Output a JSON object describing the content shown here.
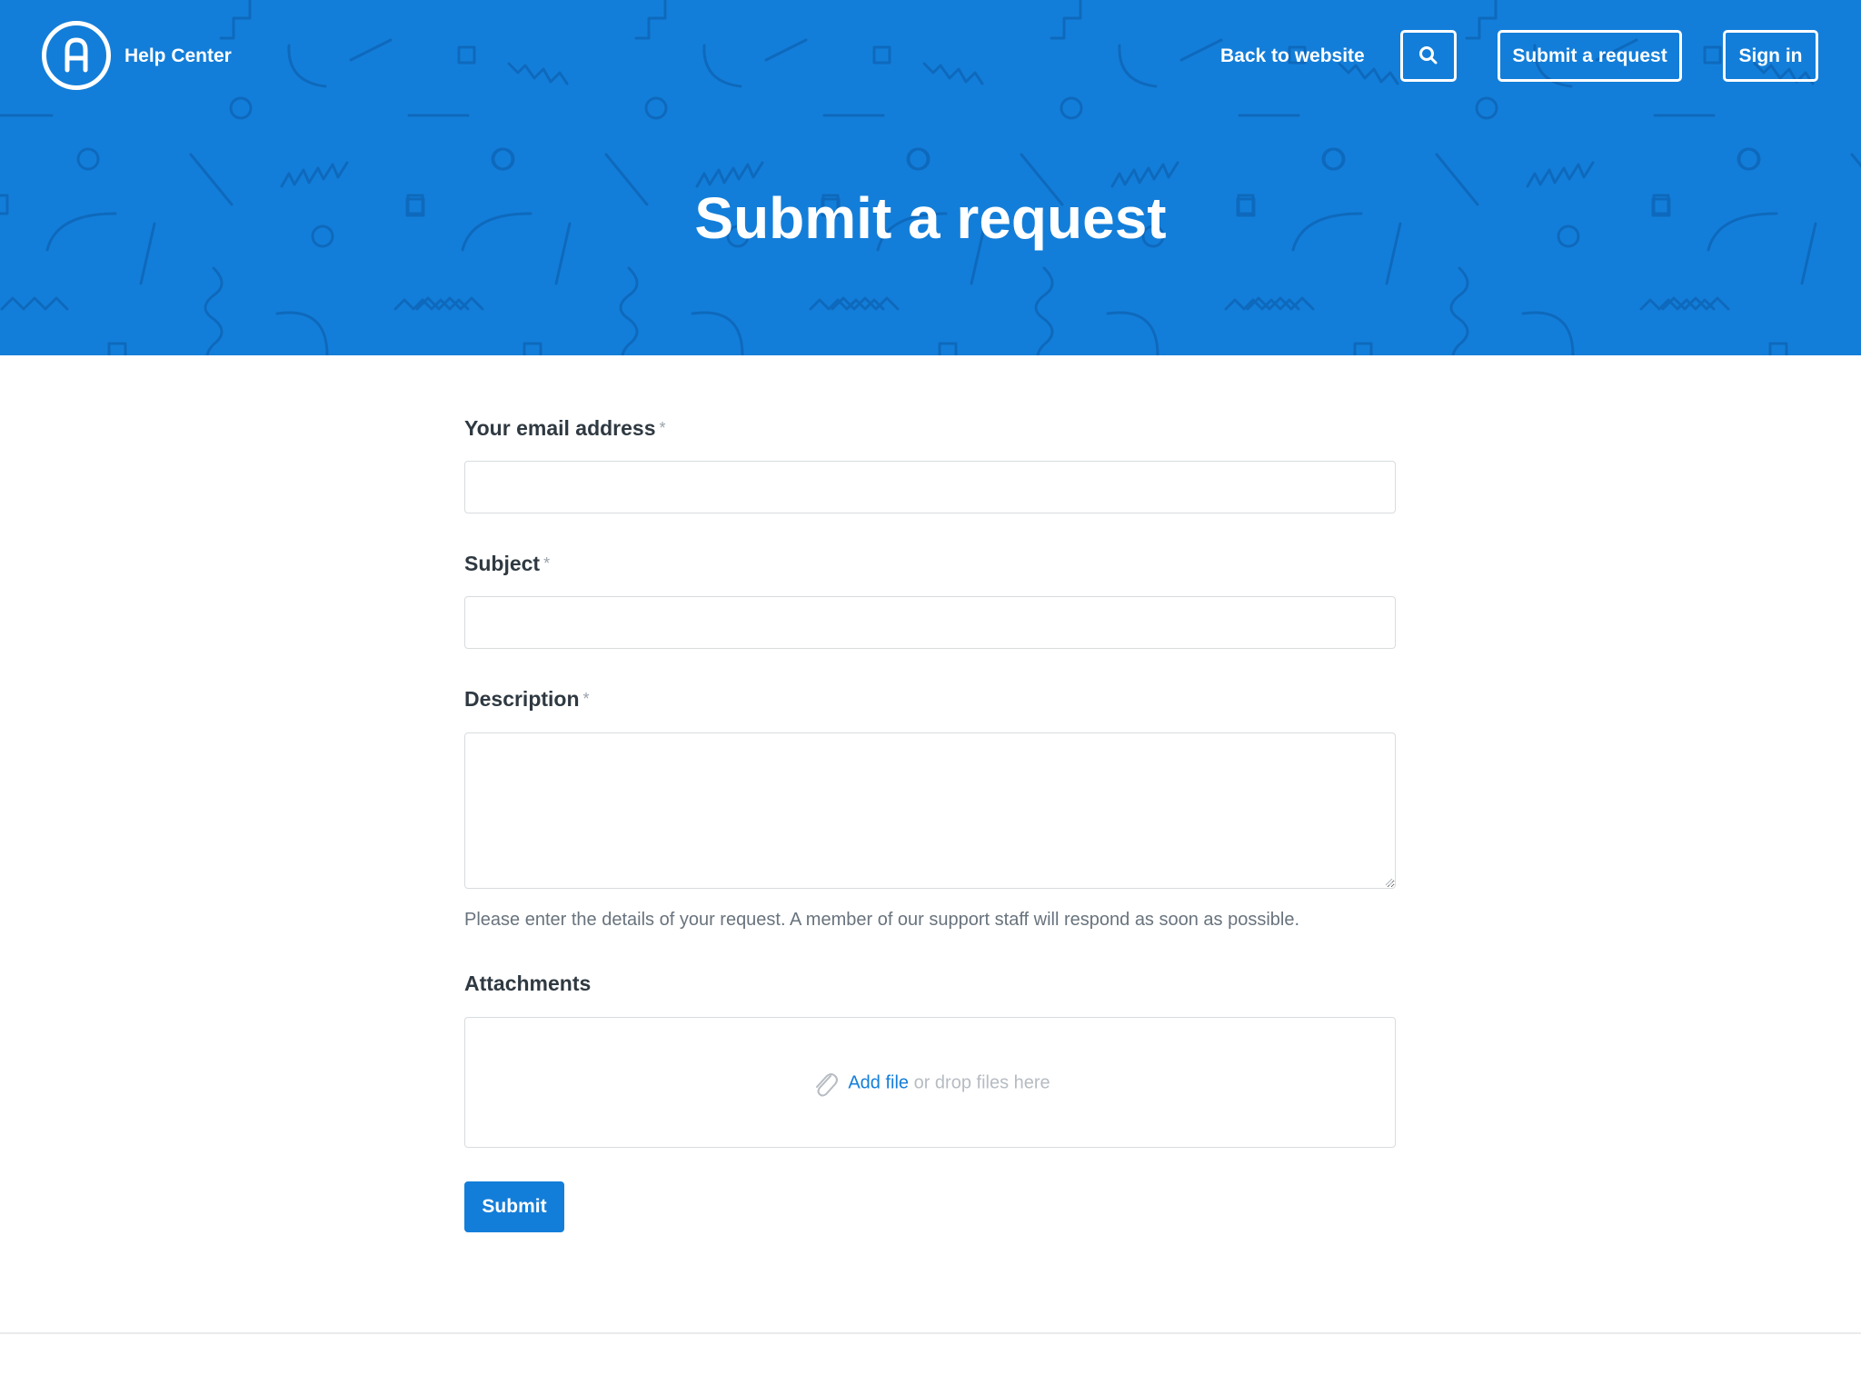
{
  "header": {
    "brand": "Help Center",
    "logo_letter": "A",
    "back_link": "Back to website",
    "search_icon": "search-icon",
    "submit_request": "Submit a request",
    "sign_in": "Sign in"
  },
  "hero": {
    "title": "Submit a request"
  },
  "form": {
    "email": {
      "label": "Your email address",
      "required_mark": "*",
      "value": ""
    },
    "subject": {
      "label": "Subject",
      "required_mark": "*",
      "value": ""
    },
    "description": {
      "label": "Description",
      "required_mark": "*",
      "value": "",
      "hint": "Please enter the details of your request. A member of our support staff will respond as soon as possible."
    },
    "attachments": {
      "label": "Attachments",
      "icon": "paperclip-icon",
      "add_file": "Add file",
      "drop_text": "or drop files here"
    },
    "submit_label": "Submit"
  },
  "colors": {
    "brand_blue": "#137ed9",
    "pattern_blue": "#0e69bc",
    "text_dark": "#2f3941",
    "text_muted": "#68737d",
    "border": "#d8dcde"
  }
}
